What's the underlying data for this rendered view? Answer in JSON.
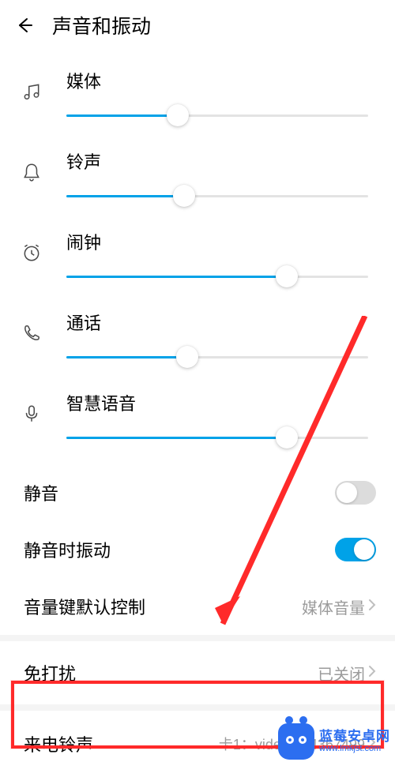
{
  "header": {
    "title": "声音和振动"
  },
  "sliders": {
    "media": {
      "label": "媒体",
      "value": 37
    },
    "ring": {
      "label": "铃声",
      "value": 39
    },
    "alarm": {
      "label": "闹钟",
      "value": 73
    },
    "call": {
      "label": "通话",
      "value": 40
    },
    "voice": {
      "label": "智慧语音",
      "value": 73
    }
  },
  "toggles": {
    "mute": {
      "label": "静音",
      "on": false
    },
    "vibrate_mute": {
      "label": "静音时振动",
      "on": true
    }
  },
  "volume_key": {
    "label": "音量键默认控制",
    "value": "媒体音量"
  },
  "dnd": {
    "label": "免打扰",
    "value": "已关闭"
  },
  "ringtone": {
    "label": "来电铃声",
    "value": "卡1：video-754367499"
  },
  "watermark": {
    "name": "蓝莓安卓网",
    "url": "www.lmkjst.com"
  }
}
